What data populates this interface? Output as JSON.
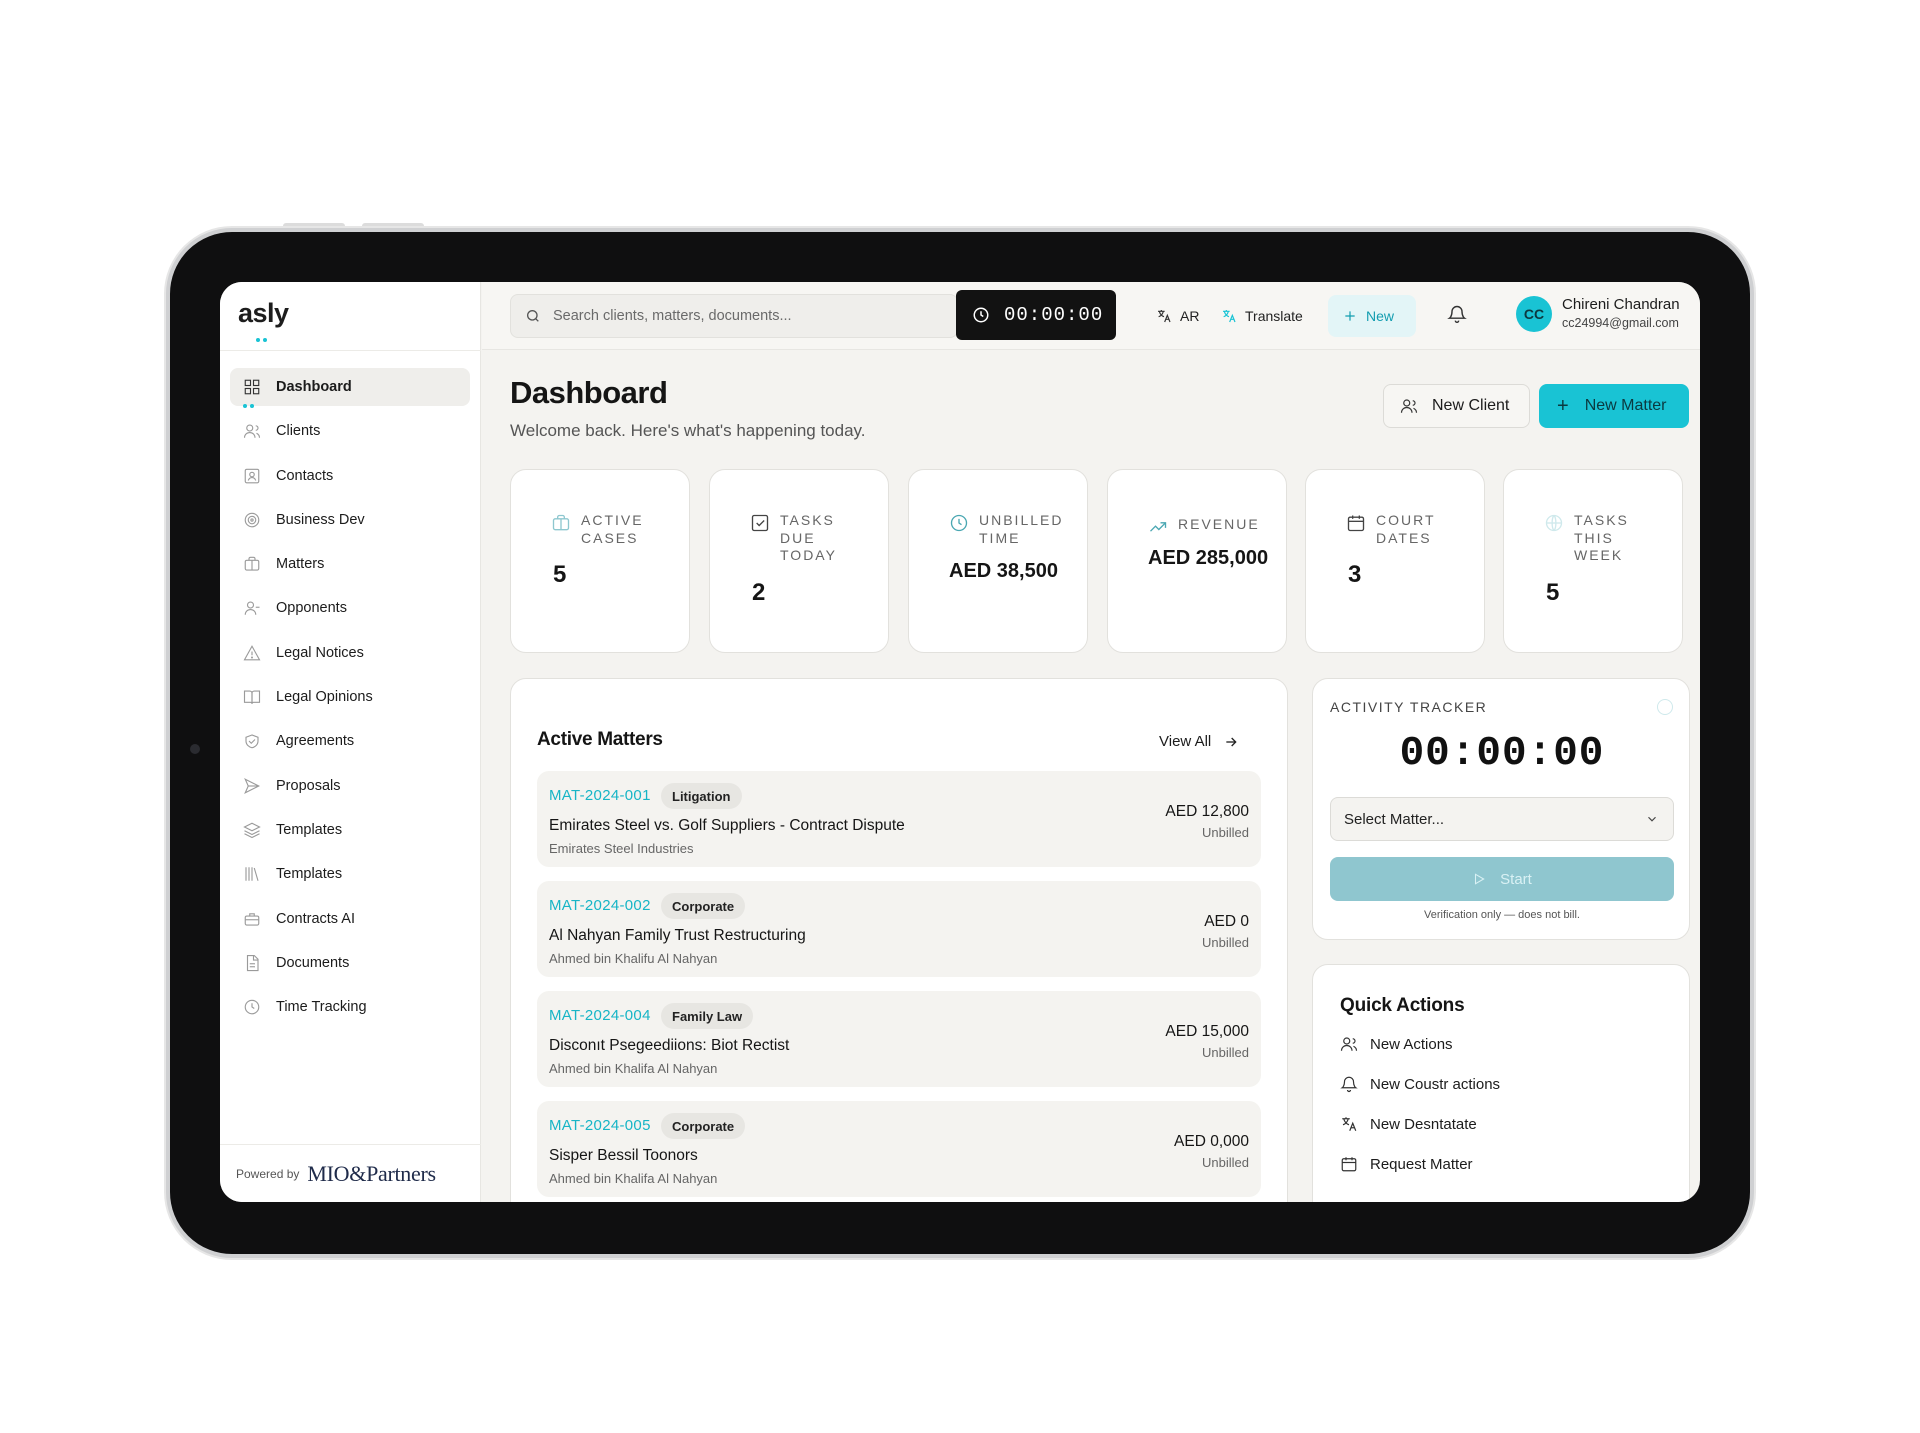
{
  "app": {
    "logo": "asly",
    "powered_by": "Powered by",
    "powered_brand": "MIO&Partners"
  },
  "sidebar": {
    "items": [
      {
        "label": "Dashboard",
        "icon": "grid-icon",
        "active": true
      },
      {
        "label": "Clients",
        "icon": "users-icon"
      },
      {
        "label": "Contacts",
        "icon": "contact-card-icon"
      },
      {
        "label": "Business Dev",
        "icon": "target-icon"
      },
      {
        "label": "Matters",
        "icon": "briefcase-icon"
      },
      {
        "label": "Opponents",
        "icon": "user-minus-icon"
      },
      {
        "label": "Legal Notices",
        "icon": "alert-triangle-icon"
      },
      {
        "label": "Legal Opinions",
        "icon": "book-open-icon"
      },
      {
        "label": "Agreements",
        "icon": "handshake-icon"
      },
      {
        "label": "Proposals",
        "icon": "send-icon"
      },
      {
        "label": "Templates",
        "icon": "layers-icon"
      },
      {
        "label": "Templates",
        "icon": "library-icon"
      },
      {
        "label": "Contracts AI",
        "icon": "briefcase-ai-icon"
      },
      {
        "label": "Documents",
        "icon": "file-text-icon"
      },
      {
        "label": "Time Tracking",
        "icon": "clock-icon"
      }
    ]
  },
  "topbar": {
    "search_placeholder": "Search clients, matters, documents...",
    "timer": "00:00:00",
    "lang_label": "AR",
    "translate_label": "Translate",
    "new_label": "New",
    "user_initials": "CC",
    "user_name": "Chireni Chandran",
    "user_email": "cc24994@gmail.com"
  },
  "header": {
    "title": "Dashboard",
    "subtitle": "Welcome back. Here's what's happening today.",
    "new_client_label": "New Client",
    "new_matter_label": "New Matter"
  },
  "stats": [
    {
      "lines": [
        "ACTIVE",
        "CASES"
      ],
      "value": "5",
      "icon": "briefcase-icon",
      "color": "#8ec7cf"
    },
    {
      "lines": [
        "TASKS",
        "DUE",
        "TODAY"
      ],
      "value": "2",
      "icon": "check-square-icon",
      "color": "#444444"
    },
    {
      "lines": [
        "UNBILLED",
        "TIME"
      ],
      "value": "AED 38,500",
      "icon": "clock-icon",
      "color": "#4aa7b2"
    },
    {
      "lines": [
        "REVENUE"
      ],
      "value": "AED 285,000",
      "icon": "trending-up-icon",
      "color": "#4aa7b2"
    },
    {
      "lines": [
        "COURT",
        "DATES"
      ],
      "value": "3",
      "icon": "calendar-icon",
      "color": "#444444"
    },
    {
      "lines": [
        "TASKS",
        "THIS",
        "WEEK"
      ],
      "value": "5",
      "icon": "globe-icon",
      "color": "#cfe9ec"
    }
  ],
  "matters": {
    "title": "Active Matters",
    "view_all": "View All",
    "rows": [
      {
        "code": "MAT-2024-001",
        "tag": "Litigation",
        "title": "Emirates Steel vs. Golf Suppliers - Contract Dispute",
        "client": "Emirates Steel Industries",
        "amount": "AED 12,800",
        "status": "Unbilled"
      },
      {
        "code": "MAT-2024-002",
        "tag": "Corporate",
        "title": "Al Nahyan Family Trust Restructuring",
        "client": "Ahmed bin Khalifu Al Nahyan",
        "amount": "AED 0",
        "status": "Unbilled"
      },
      {
        "code": "MAT-2024-004",
        "tag": "Family Law",
        "title": "Disconıt Psegeediions: Biot Rectist",
        "client": "Ahmed bin Khalifa Al Nahyan",
        "amount": "AED 15,000",
        "status": "Unbilled"
      },
      {
        "code": "MAT-2024-005",
        "tag": "Corporate",
        "title": "Sisper Bessil Toonors",
        "client": "Ahmed bin Khalifa Al Nahyan",
        "amount": "AED 0,000",
        "status": "Unbilled"
      }
    ]
  },
  "tracker": {
    "title": "ACTIVITY TRACKER",
    "time": "00:00:00",
    "select_placeholder": "Select Matter...",
    "start_label": "Start",
    "note": "Verification only — does not bill."
  },
  "quick_actions": {
    "title": "Quick Actions",
    "items": [
      {
        "label": "New Actions",
        "icon": "users-icon"
      },
      {
        "label": "New Coustr actions",
        "icon": "bell-icon"
      },
      {
        "label": "New Desntatate",
        "icon": "translate-icon"
      },
      {
        "label": "Request Matter",
        "icon": "calendar-icon"
      }
    ]
  },
  "colors": {
    "accent": "#19c3d4",
    "accent_text": "#17b5c6"
  }
}
